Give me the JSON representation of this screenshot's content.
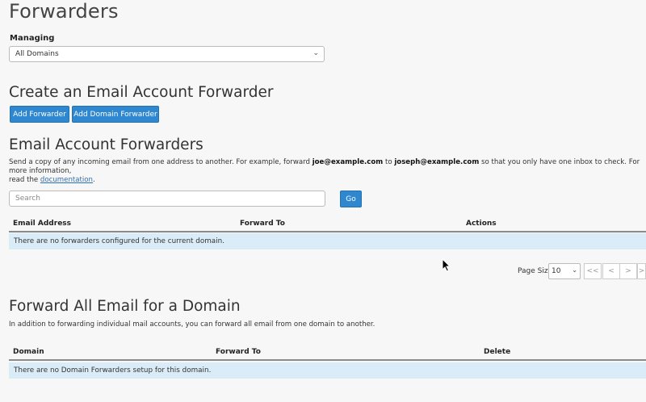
{
  "page_title": "Forwarders",
  "managing": {
    "label": "Managing",
    "selected": "All Domains"
  },
  "create_section": {
    "title": "Create an Email Account Forwarder",
    "add_forwarder": "Add Forwarder",
    "add_domain_forwarder": "Add Domain Forwarder"
  },
  "email_forwarders": {
    "title": "Email Account Forwarders",
    "desc_part1": "Send a copy of any incoming email from one address to another. For example, forward ",
    "example_from": "joe@example.com",
    "desc_to": " to ",
    "example_to": "joseph@example.com",
    "desc_part2": " so that you only have one inbox to check. For more information,",
    "desc_read": "read the ",
    "doc_link": "documentation",
    "desc_end": ".",
    "search_placeholder": "Search",
    "go_label": "Go",
    "columns": [
      "Email Address",
      "Forward To",
      "Actions"
    ],
    "empty_message": "There are no forwarders configured for the current domain.",
    "page_size_label": "Page Size",
    "page_size_value": "10",
    "pager": [
      "<<",
      "<",
      ">",
      ">"
    ]
  },
  "domain_forwarders": {
    "title": "Forward All Email for a Domain",
    "desc": "In addition to forwarding individual mail accounts, you can forward all email from one domain to another.",
    "columns": [
      "Domain",
      "Forward To",
      "Delete"
    ],
    "empty_message": "There are no Domain Forwarders setup for this domain."
  },
  "colors": {
    "primary_button": "#2e87cf",
    "info_row": "#d9ecf7",
    "link": "#2e6fb5"
  }
}
